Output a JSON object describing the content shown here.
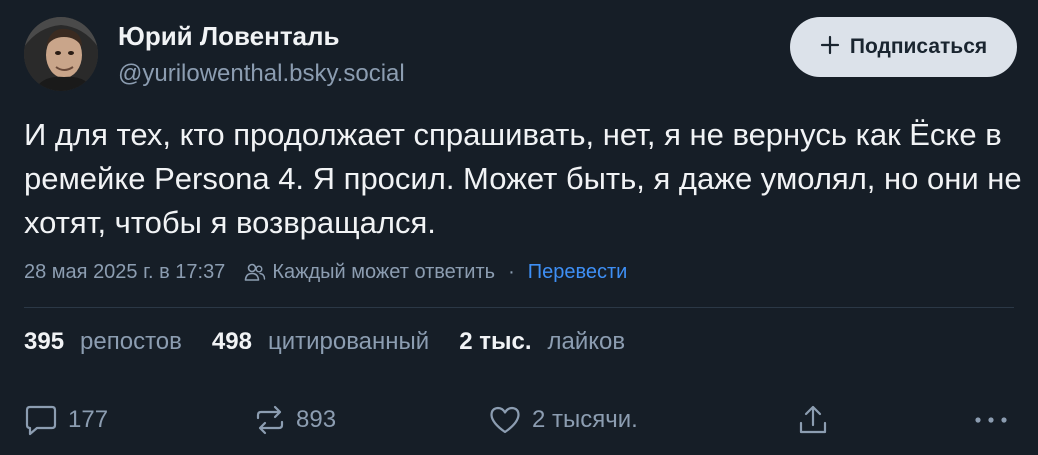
{
  "author": {
    "display_name": "Юрий Ловенталь",
    "handle": "@yurilowenthal.bsky.social",
    "avatar_icon": "avatar-photo"
  },
  "header": {
    "subscribe_label": "Подписаться",
    "subscribe_icon": "plus-icon"
  },
  "post": {
    "text": "И для тех, кто продолжает спрашивать, нет, я не вернусь как Ёске в ремейке Persona 4. Я просил. Может быть, я даже умолял, но они не хотят, чтобы я возвращался.",
    "timestamp": "28 мая 2025 г. в 17:37",
    "reply_setting": "Каждый может ответить",
    "separator": "·",
    "translate_label": "Перевести"
  },
  "stats": {
    "reposts_count": "395",
    "reposts_label": "репостов",
    "quotes_count": "498",
    "quotes_label": "цитированный",
    "likes_count": "2 тыс.",
    "likes_label": "лайков"
  },
  "actions": {
    "reply_count": "177",
    "repost_count": "893",
    "like_count": "2 тысячи.",
    "reply_icon": "reply-icon",
    "repost_icon": "repost-icon",
    "like_icon": "heart-icon",
    "share_icon": "share-icon",
    "more_icon": "more-icon"
  },
  "colors": {
    "background": "#161e27",
    "text": "#f1f3f5",
    "muted": "#8c9db1",
    "link": "#3e8ff5",
    "button_bg": "#dce2ea"
  }
}
